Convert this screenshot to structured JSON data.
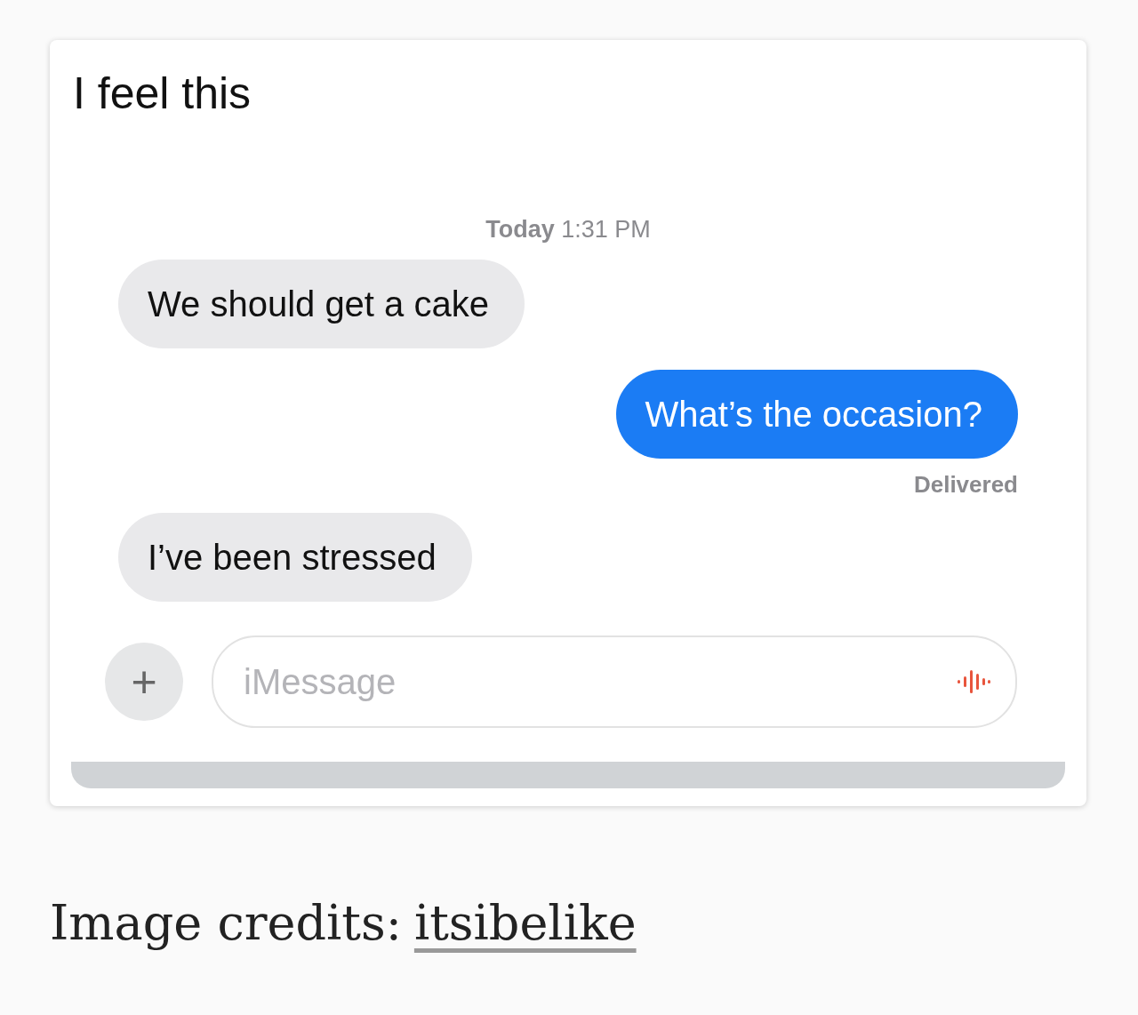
{
  "post": {
    "title": "I feel this"
  },
  "conversation": {
    "timestamp": "**Today** 1:31 PM",
    "messages": [
      {
        "text": "We should get a cake",
        "kind": "incoming"
      },
      {
        "text": "What’s the occasion?",
        "kind": "outgoing",
        "status": "Delivered"
      },
      {
        "text": "I’ve been stressed",
        "kind": "incoming"
      }
    ]
  },
  "composer": {
    "button": "+",
    "placeholder": "iMessage"
  },
  "caption": {
    "label": "Image credits:",
    "link": "itsibelike"
  }
}
